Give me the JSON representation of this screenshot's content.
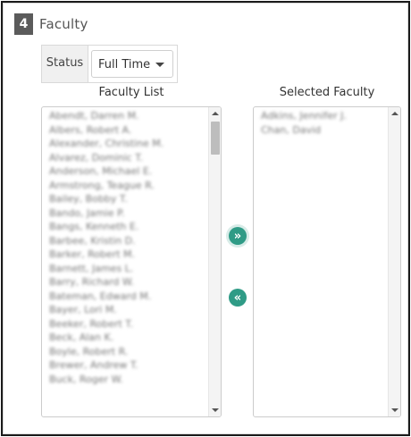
{
  "section": {
    "number": "4",
    "title": "Faculty"
  },
  "status": {
    "label": "Status",
    "selected": "Full Time"
  },
  "faculty_list": {
    "title": "Faculty List",
    "items": [
      "Abendt, Darren M.",
      "Albers, Robert A.",
      "Alexander, Christine M.",
      "Alvarez, Dominic T.",
      "Anderson, Michael E.",
      "Armstrong, Teague R.",
      "Bailey, Bobby T.",
      "Bando, Jamie P.",
      "Bangs, Kenneth E.",
      "Barbee, Kristin D.",
      "Barker, Robert M.",
      "Barnett, James L.",
      "Barry, Richard W.",
      "Bateman, Edward M.",
      "Bayer, Lori M.",
      "Beeker, Robert T.",
      "Beck, Alan K.",
      "Boyle, Robert R.",
      "Brewer, Andrew T.",
      "Buck, Roger W."
    ]
  },
  "selected_list": {
    "title": "Selected Faculty",
    "items": [
      "Adkins, Jennifer J.",
      "Chan, David"
    ]
  },
  "buttons": {
    "move_right": "»",
    "move_left": "«"
  }
}
